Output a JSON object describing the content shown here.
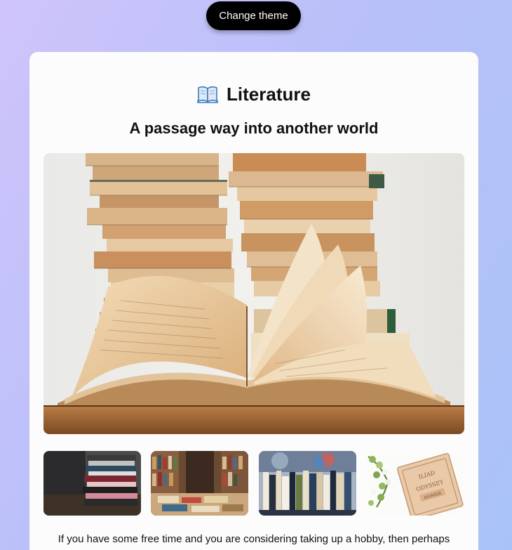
{
  "header": {
    "theme_button_label": "Change theme"
  },
  "card": {
    "title_icon": "open-book-icon",
    "title": "Literature",
    "subtitle": "A passage way into another world",
    "hero_image": "books-open-book-photo",
    "thumbnails": [
      {
        "name": "stacked-books-photo"
      },
      {
        "name": "bookstore-shelves-photo"
      },
      {
        "name": "bookshelf-spines-photo"
      },
      {
        "name": "iliad-odyssey-book-photo",
        "text_lines": [
          "ILIAD",
          "ODYSSEY",
          "HOMER"
        ]
      }
    ],
    "paragraph": "If you have some free time and you are considering taking up a hobby, then perhaps"
  },
  "colors": {
    "background_start": "#cfc4fb",
    "background_end": "#a9c3f8",
    "card": "#fcfcfc",
    "button": "#000000"
  }
}
